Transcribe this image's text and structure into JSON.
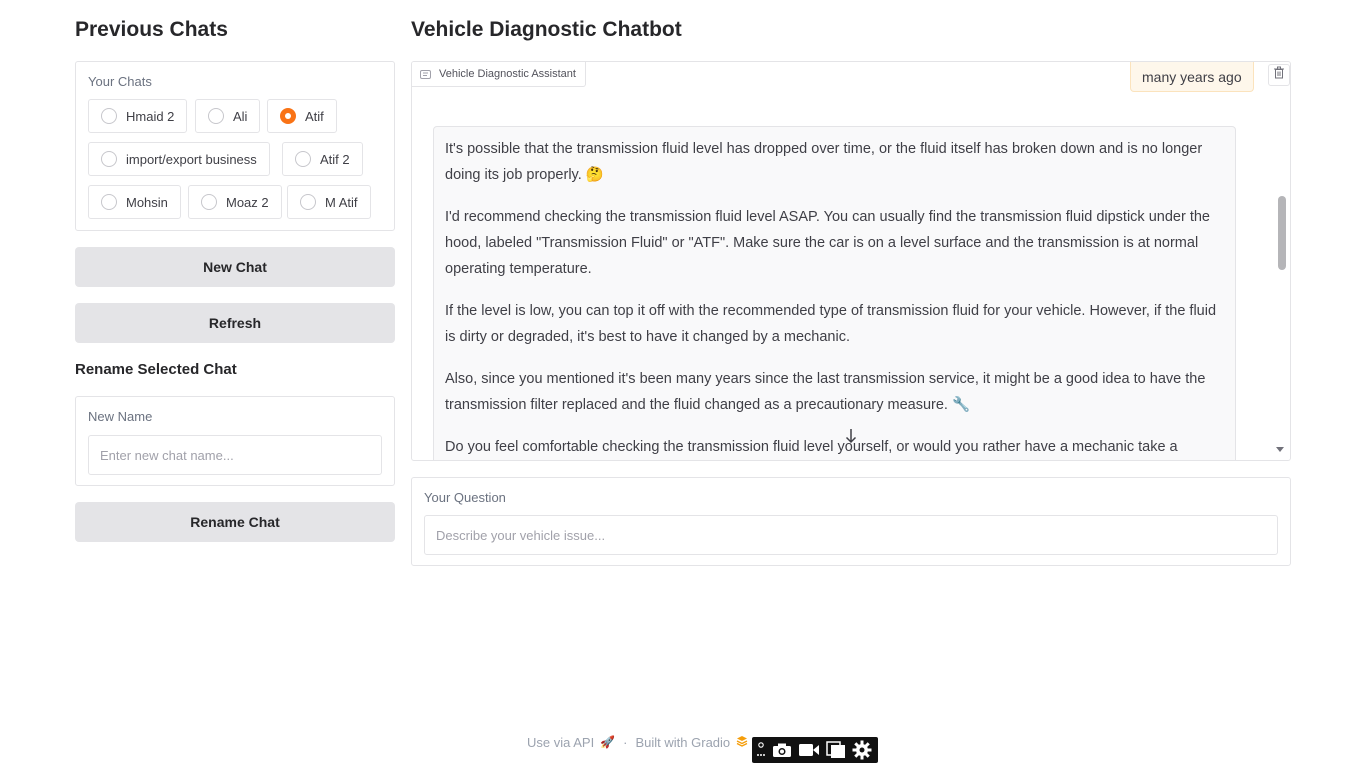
{
  "sidebar": {
    "title": "Previous Chats",
    "chats_label": "Your Chats",
    "chats": [
      {
        "label": "Hmaid 2",
        "selected": false
      },
      {
        "label": "Ali",
        "selected": false
      },
      {
        "label": "Atif",
        "selected": true
      },
      {
        "label": "import/export business",
        "selected": false
      },
      {
        "label": "Atif 2",
        "selected": false
      },
      {
        "label": "Mohsin",
        "selected": false
      },
      {
        "label": "Moaz 2",
        "selected": false
      },
      {
        "label": "M Atif",
        "selected": false
      }
    ],
    "new_chat_label": "New Chat",
    "refresh_label": "Refresh",
    "rename_title": "Rename Selected Chat",
    "new_name_label": "New Name",
    "new_name_placeholder": "Enter new chat name...",
    "new_name_value": "",
    "rename_button_label": "Rename Chat"
  },
  "main": {
    "title": "Vehicle Diagnostic Chatbot",
    "chatbot_label": "Vehicle Diagnostic Assistant",
    "timestamp": "many years ago",
    "messages": [
      {
        "role": "assistant",
        "paragraphs": [
          "It's possible that the transmission fluid level has dropped over time, or the fluid itself has broken down and is no longer doing its job properly. 🤔",
          "I'd recommend checking the transmission fluid level ASAP. You can usually find the transmission fluid dipstick under the hood, labeled \"Transmission Fluid\" or \"ATF\". Make sure the car is on a level surface and the transmission is at normal operating temperature.",
          "If the level is low, you can top it off with the recommended type of transmission fluid for your vehicle. However, if the fluid is dirty or degraded, it's best to have it changed by a mechanic.",
          "Also, since you mentioned it's been many years since the last transmission service, it might be a good idea to have the transmission filter replaced and the fluid changed as a precautionary measure. 🔧",
          "Do you feel comfortable checking the transmission fluid level yourself, or would you rather have a mechanic take a"
        ]
      }
    ],
    "question_label": "Your Question",
    "question_placeholder": "Describe your vehicle issue...",
    "question_value": ""
  },
  "footer": {
    "api_label": "Use via API",
    "separator": "·",
    "built_label": "Built with Gradio"
  },
  "colors": {
    "accent": "#f97316",
    "button_bg": "#e4e4e7",
    "border": "#e4e4e7",
    "timestamp_bg": "#fef7eb"
  }
}
